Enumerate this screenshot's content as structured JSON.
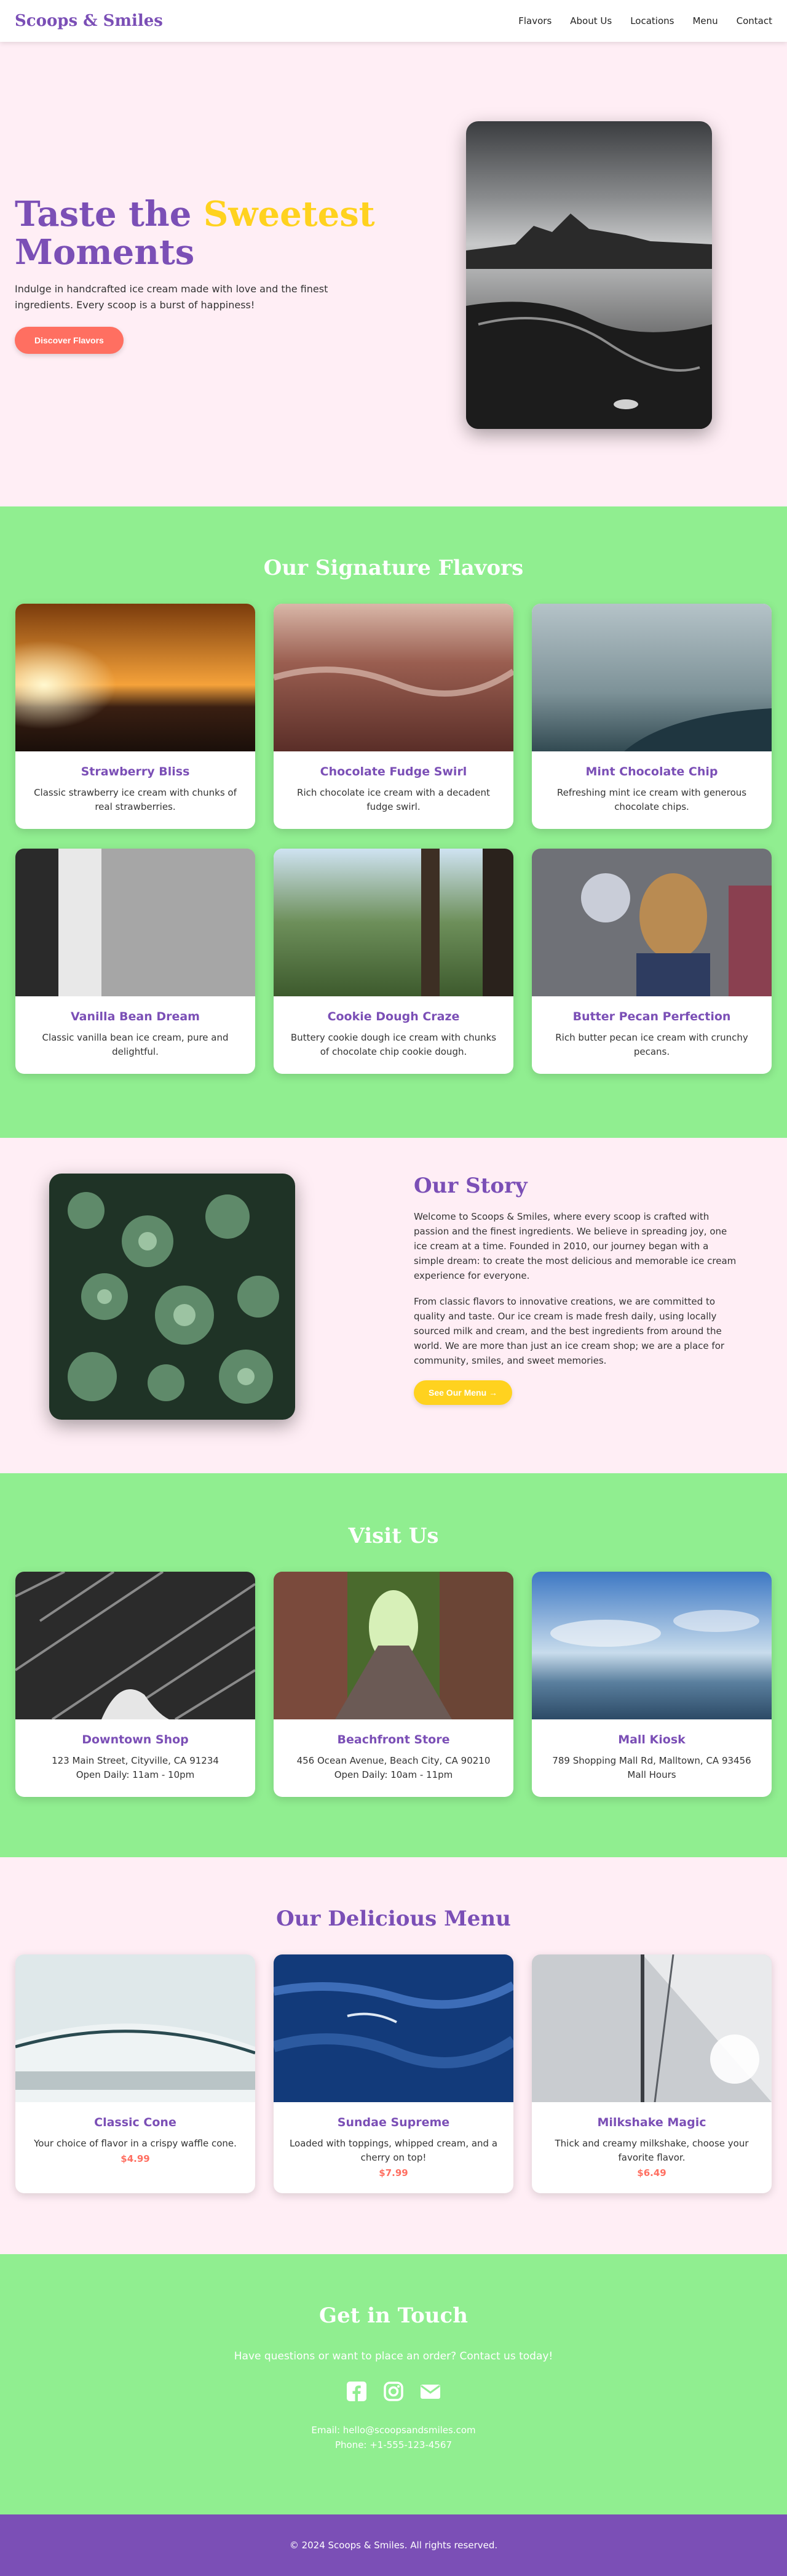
{
  "nav": {
    "logo": "Scoops & Smiles",
    "links": [
      "Flavors",
      "About Us",
      "Locations",
      "Menu",
      "Contact"
    ]
  },
  "hero": {
    "title_part1": "Taste the ",
    "title_accent": "Sweetest",
    "title_part2": "Moments",
    "description": "Indulge in handcrafted ice cream made with love and the finest ingredients. Every scoop is a burst of happiness!",
    "button": "Discover Flavors"
  },
  "flavors": {
    "title": "Our Signature Flavors",
    "items": [
      {
        "name": "Strawberry Bliss",
        "desc": "Classic strawberry ice cream with chunks of real strawberries."
      },
      {
        "name": "Chocolate Fudge Swirl",
        "desc": "Rich chocolate ice cream with a decadent fudge swirl."
      },
      {
        "name": "Mint Chocolate Chip",
        "desc": "Refreshing mint ice cream with generous chocolate chips."
      },
      {
        "name": "Vanilla Bean Dream",
        "desc": "Classic vanilla bean ice cream, pure and delightful."
      },
      {
        "name": "Cookie Dough Craze",
        "desc": "Buttery cookie dough ice cream with chunks of chocolate chip cookie dough."
      },
      {
        "name": "Butter Pecan Perfection",
        "desc": "Rich butter pecan ice cream with crunchy pecans."
      }
    ]
  },
  "story": {
    "title": "Our Story",
    "p1": "Welcome to Scoops & Smiles, where every scoop is crafted with passion and the finest ingredients. We believe in spreading joy, one ice cream at a time. Founded in 2010, our journey began with a simple dream: to create the most delicious and memorable ice cream experience for everyone.",
    "p2": "From classic flavors to innovative creations, we are committed to quality and taste. Our ice cream is made fresh daily, using locally sourced milk and cream, and the best ingredients from around the world. We are more than just an ice cream shop; we are a place for community, smiles, and sweet memories.",
    "button": "See Our Menu",
    "button_icon": "arrow-right-icon"
  },
  "visit": {
    "title": "Visit Us",
    "items": [
      {
        "name": "Downtown Shop",
        "line1": "123 Main Street, Cityville, CA 91234",
        "line2": "Open Daily: 11am - 10pm"
      },
      {
        "name": "Beachfront Store",
        "line1": "456 Ocean Avenue, Beach City, CA 90210",
        "line2": "Open Daily: 10am - 11pm"
      },
      {
        "name": "Mall Kiosk",
        "line1": "789 Shopping Mall Rd, Malltown, CA 93456",
        "line2": "Mall Hours"
      }
    ]
  },
  "menu": {
    "title": "Our Delicious Menu",
    "items": [
      {
        "name": "Classic Cone",
        "desc": "Your choice of flavor in a crispy waffle cone.",
        "price": "$4.99"
      },
      {
        "name": "Sundae Supreme",
        "desc": "Loaded with toppings, whipped cream, and a cherry on top!",
        "price": "$7.99"
      },
      {
        "name": "Milkshake Magic",
        "desc": "Thick and creamy milkshake, choose your favorite flavor.",
        "price": "$6.49"
      }
    ]
  },
  "contact": {
    "title": "Get in Touch",
    "lead": "Have questions or want to place an order? Contact us today!",
    "socials": [
      "facebook-icon",
      "instagram-icon",
      "envelope-icon"
    ],
    "email": "Email: hello@scoopsandsmiles.com",
    "phone": "Phone: +1-555-123-4567"
  },
  "footer": {
    "text": "© 2024 Scoops & Smiles. All rights reserved."
  },
  "colors": {
    "primary_purple": "#7b4fb6",
    "accent_yellow": "#ffd21f",
    "coral": "#ff6f61",
    "green": "#90ee90",
    "pink_bg": "#ffeef5"
  }
}
